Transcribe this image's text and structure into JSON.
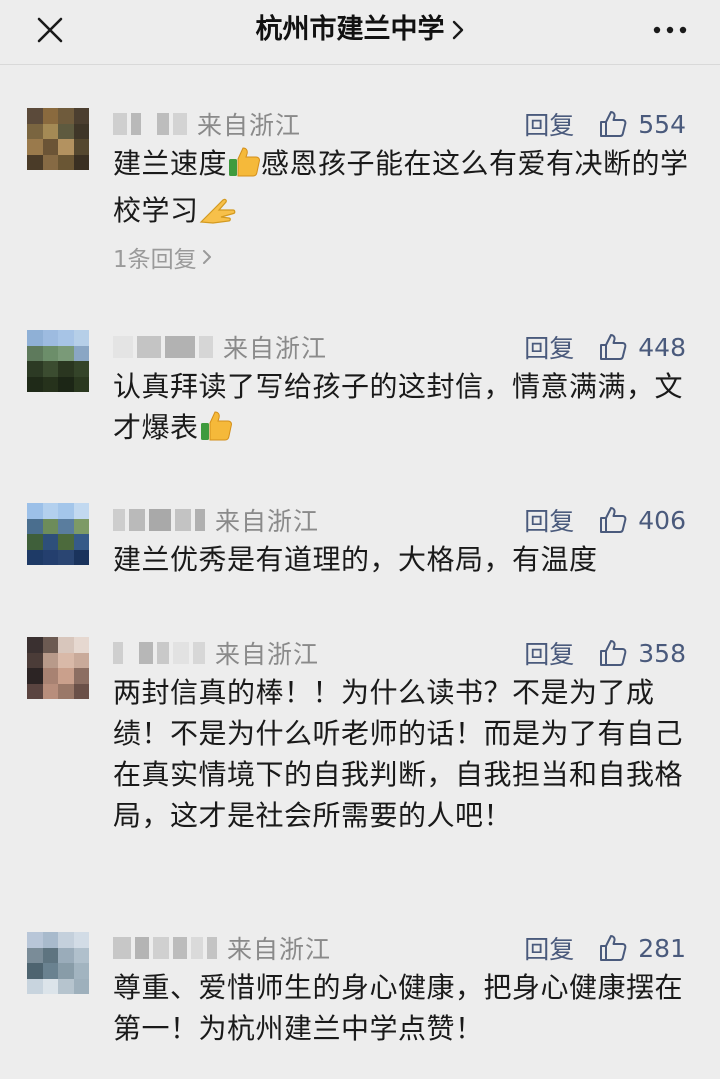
{
  "nav": {
    "title": "杭州市建兰中学",
    "close_icon": "close-icon",
    "more_icon": "more-icon",
    "chevron_icon": "chevron-right-icon"
  },
  "comments": [
    {
      "location": "来自浙江",
      "reply_label": "回复",
      "likes": "554",
      "text_a": "建兰速度",
      "text_b": "感恩孩子能在这么有爱有决断的学校学习",
      "sub_replies": "1条回复"
    },
    {
      "location": "来自浙江",
      "reply_label": "回复",
      "likes": "448",
      "text_a": "认真拜读了写给孩子的这封信，情意满满，文才爆表"
    },
    {
      "location": "来自浙江",
      "reply_label": "回复",
      "likes": "406",
      "text_a": "建兰优秀是有道理的，大格局，有温度"
    },
    {
      "location": "来自浙江",
      "reply_label": "回复",
      "likes": "358",
      "text_a": "两封信真的棒！！为什么读书？不是为了成绩！不是为什么听老师的话！而是为了有自己在真实情境下的自我判断，自我担当和自我格局，这才是社会所需要的人吧！"
    },
    {
      "location": "来自浙江",
      "reply_label": "回复",
      "likes": "281",
      "text_a": "尊重、爱惜师生的身心健康，把身心健康摆在第一！为杭州建兰中学点赞！"
    }
  ]
}
